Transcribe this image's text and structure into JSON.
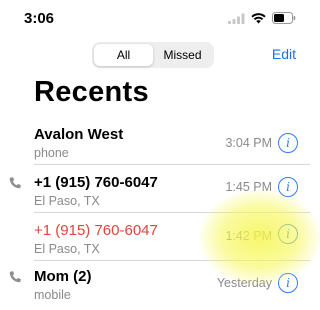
{
  "status": {
    "time": "3:06"
  },
  "tabs": [
    {
      "label": "All",
      "active": true
    },
    {
      "label": "Missed",
      "active": false
    }
  ],
  "edit_label": "Edit",
  "title": "Recents",
  "calls": [
    {
      "name": "Avalon West",
      "subtitle": "phone",
      "time": "3:04 PM",
      "missed": false,
      "outgoing_icon": false
    },
    {
      "name": "+1 (915) 760-6047",
      "subtitle": "El Paso, TX",
      "time": "1:45 PM",
      "missed": false,
      "outgoing_icon": true
    },
    {
      "name": "+1 (915) 760-6047",
      "subtitle": "El Paso, TX",
      "time": "1:42 PM",
      "missed": true,
      "outgoing_icon": false
    },
    {
      "name": "Mom (2)",
      "subtitle": "mobile",
      "time": "Yesterday",
      "missed": false,
      "outgoing_icon": true
    }
  ],
  "info_glyph": "i",
  "colors": {
    "accent": "#1a73e8",
    "missed": "#e0443a",
    "secondary": "#8a8a8e"
  },
  "icons": [
    "cellular-signal-icon",
    "wifi-icon",
    "battery-icon",
    "outgoing-call-icon",
    "info-icon"
  ]
}
